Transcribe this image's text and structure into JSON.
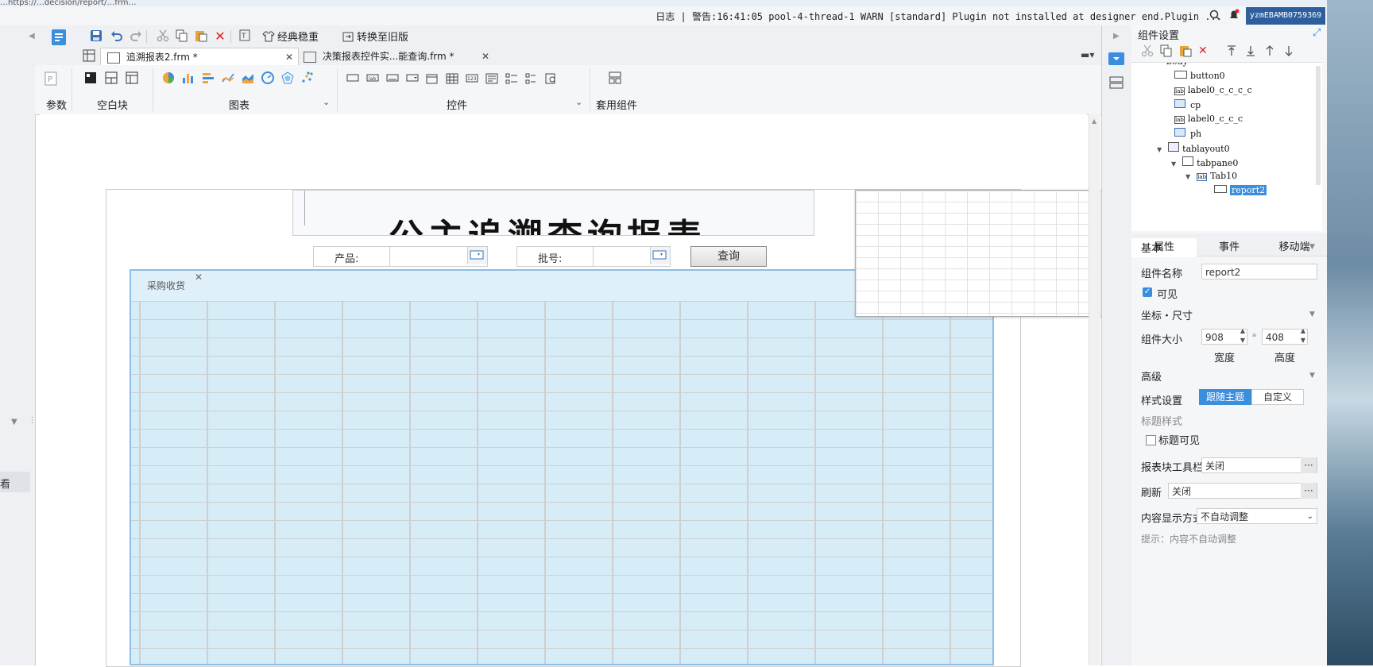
{
  "window": {
    "top_url_fragment": "…https://…decision/report/…frm…",
    "log_label": "日志",
    "log_message": "警告:16:41:05 pool-4-thread-1 WARN [standard] Plugin not installed at designer end.Plugin ...",
    "username": "yzmEBAMB0759369"
  },
  "toolbar": {
    "classic_theme": "经典稳重",
    "convert_old": "转换至旧版"
  },
  "tabs": [
    {
      "label": "追溯报表2.frm *"
    },
    {
      "label": "决策报表控件实...能查询.frm *"
    }
  ],
  "ribbon": {
    "params": "参数",
    "blank_block": "空白块",
    "chart": "图表",
    "widgets": "控件",
    "template_component": "套用组件"
  },
  "canvas": {
    "title_text": "公主追溯查询报表",
    "product_label": "产品:",
    "product_value": "",
    "batch_label": "批号:",
    "batch_value": "",
    "query_button": "查询",
    "tab_name": "采购收货"
  },
  "right_panel": {
    "title": "组件设置",
    "tree": [
      {
        "label": "body"
      },
      {
        "label": "button0"
      },
      {
        "label": "label0_c_c_c_c"
      },
      {
        "label": "cp"
      },
      {
        "label": "label0_c_c_c"
      },
      {
        "label": "ph"
      },
      {
        "label": "tablayout0"
      },
      {
        "label": "tabpane0"
      },
      {
        "label": "Tab10"
      },
      {
        "label": "report2"
      }
    ],
    "tabs": [
      "属性",
      "事件",
      "移动端"
    ],
    "section_basic": "基本",
    "component_name_label": "组件名称",
    "component_name_value": "report2",
    "visible_label": "可见",
    "section_position": "坐标・尺寸",
    "size_label": "组件大小",
    "width_value": "908",
    "height_value": "408",
    "width_caption": "宽度",
    "height_caption": "高度",
    "section_advanced": "高级",
    "style_label": "样式设置",
    "style_follow": "跟随主题",
    "style_custom": "自定义",
    "title_style_label": "标题样式",
    "title_visible_label": "标题可见",
    "toolbar_label": "报表块工具栏",
    "toolbar_value": "关闭",
    "refresh_label": "刷新",
    "refresh_value": "关闭",
    "display_mode_label": "内容显示方式",
    "display_mode_value": "不自动调整",
    "hint": "提示：内容不自动调整"
  },
  "left_panel": {
    "item": "看"
  },
  "colors": {
    "accent": "#3b8ddd",
    "grid_fill": "#d6ecf7",
    "selection_border": "#8cbfe8"
  }
}
